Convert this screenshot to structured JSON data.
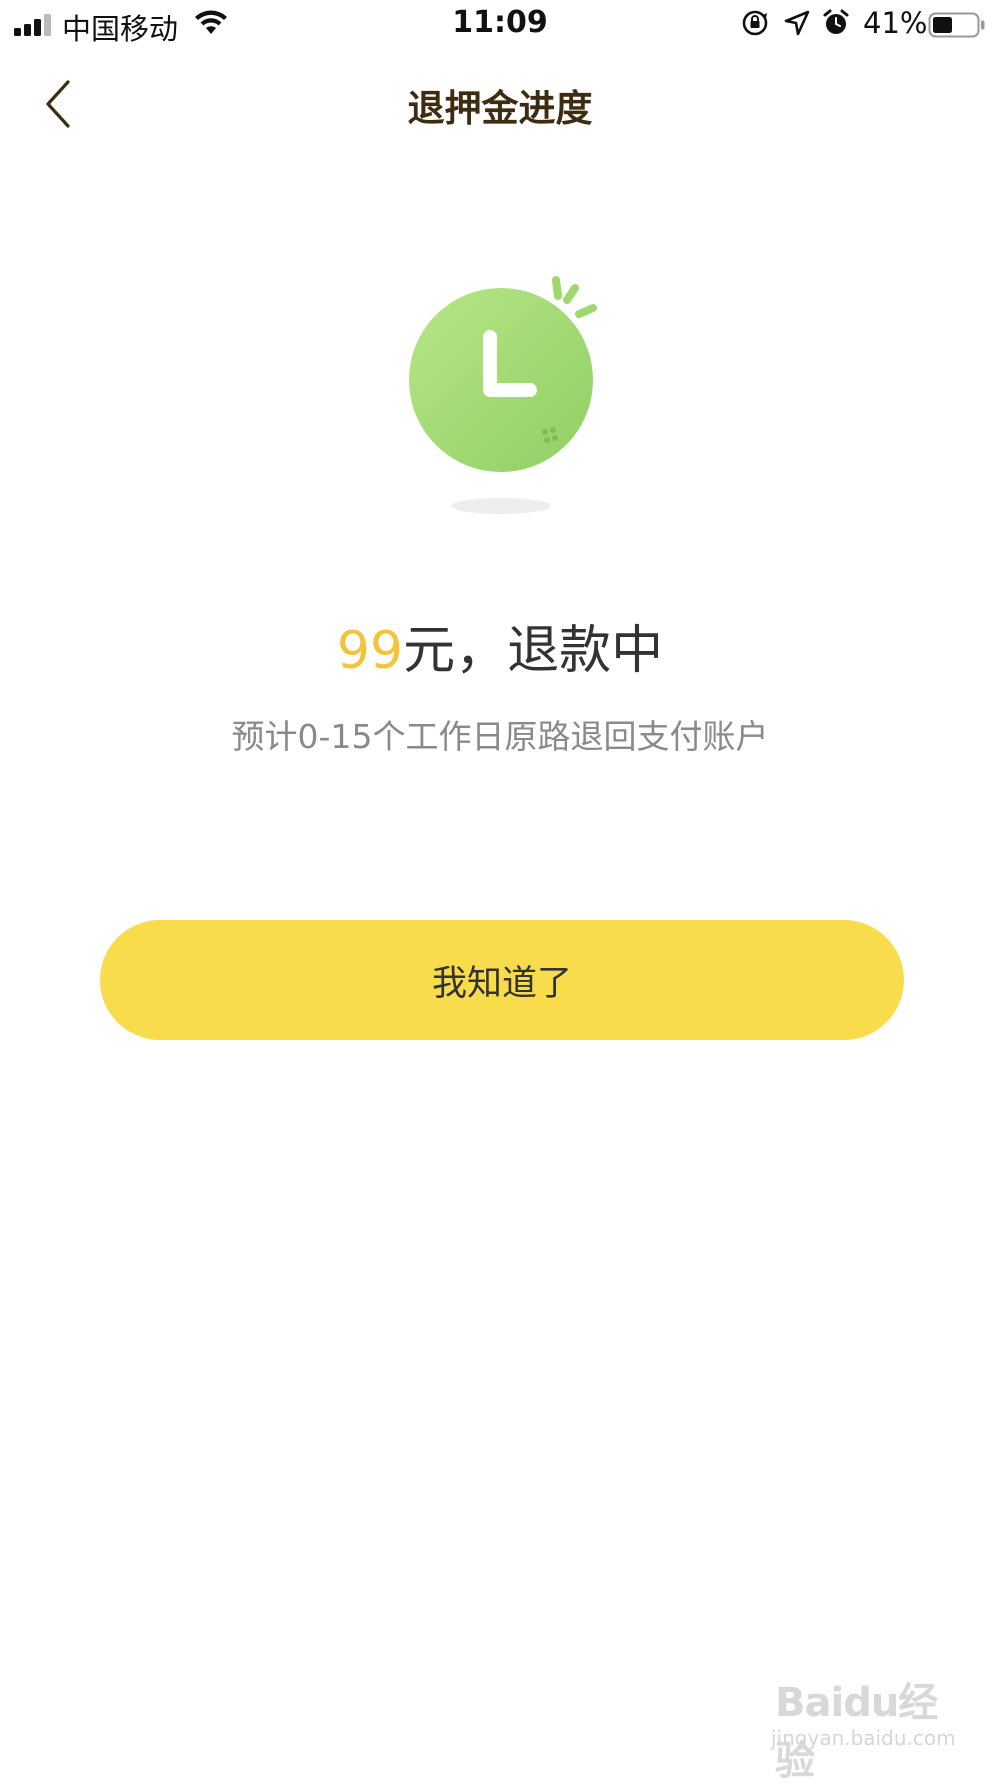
{
  "status_bar": {
    "carrier": "中国移动",
    "time": "11:09",
    "battery_percent": "41%",
    "icons": [
      "signal-icon",
      "wifi-icon",
      "rotation-lock-icon",
      "location-arrow-icon",
      "alarm-icon",
      "battery-icon"
    ]
  },
  "nav": {
    "back_icon": "chevron-left-icon",
    "title": "退押金进度"
  },
  "status": {
    "icon": "clock-icon",
    "amount": "99",
    "text": "元，退款中",
    "subtitle": "预计0-15个工作日原路退回支付账户"
  },
  "button": {
    "label": "我知道了"
  },
  "watermark": {
    "brand": "Baidu经验",
    "url": "jingyan.baidu.com"
  },
  "colors": {
    "accent_yellow": "#f8dc4c",
    "amount_yellow": "#f5c33b",
    "clock_green": "#9fd86e",
    "title_brown": "#3d2c10"
  }
}
